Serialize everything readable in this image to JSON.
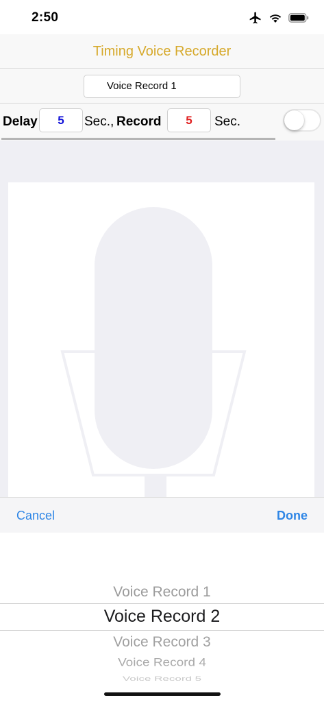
{
  "status": {
    "time": "2:50",
    "icons": [
      "airplane-icon",
      "wifi-icon",
      "battery-icon"
    ]
  },
  "nav": {
    "title": "Timing Voice Recorder",
    "title_color": "#d6a92b"
  },
  "record": {
    "name": "Voice Record 1"
  },
  "timing": {
    "delay_label": "Delay",
    "delay_value": "5",
    "delay_color": "#1010d8",
    "delay_unit": "Sec.,",
    "record_label": "Record",
    "record_value": "5",
    "record_color": "#e02020",
    "record_unit": "Sec.",
    "toggle_on": false,
    "progress": 0
  },
  "toolbar": {
    "cancel_label": "Cancel",
    "done_label": "Done",
    "accent": "#2f86e6"
  },
  "picker": {
    "items": [
      "Voice Record 1",
      "Voice Record 2",
      "Voice Record 3",
      "Voice Record 4",
      "Voice Record 5"
    ],
    "selected": "Voice Record 2"
  }
}
